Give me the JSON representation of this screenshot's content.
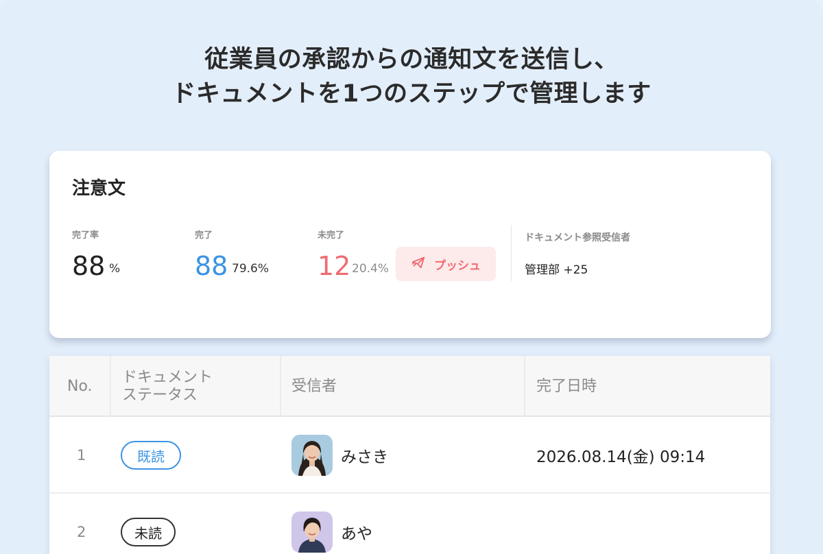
{
  "headline": {
    "line1": "従業員の承認からの通知文を送信し、",
    "line2": "ドキュメントを1つのステップで管理します"
  },
  "card": {
    "title": "注意文",
    "completion_rate": {
      "label": "完了率",
      "value": "88",
      "unit": "%"
    },
    "completed": {
      "label": "完了",
      "value": "88",
      "percent": "79.6%"
    },
    "incomplete": {
      "label": "未完了",
      "value": "12",
      "percent": "20.4%"
    },
    "push_button": {
      "label": "プッシュ",
      "icon": "push-send-icon"
    },
    "recipients": {
      "label": "ドキュメント参照受信者",
      "value": "管理部 +25"
    }
  },
  "table": {
    "headers": {
      "no": "No.",
      "status_line1": "ドキュメント",
      "status_line2": "ステータス",
      "recipient": "受信者",
      "completed_at": "完了日時"
    },
    "rows": [
      {
        "no": "1",
        "status": "既読",
        "recipient": "みさき",
        "completed_at": "2026.08.14(金) 09:14"
      },
      {
        "no": "2",
        "status": "未読",
        "recipient": "あや",
        "completed_at": ""
      }
    ]
  },
  "colors": {
    "background": "#e3eefb",
    "accent_blue": "#3b93e3",
    "accent_red": "#ee6b72",
    "push_bg": "#fdeaea"
  }
}
